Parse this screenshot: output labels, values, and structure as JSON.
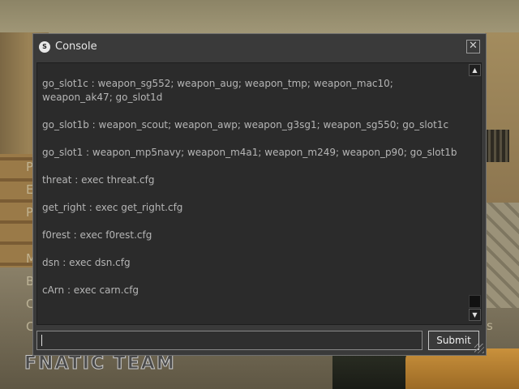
{
  "console": {
    "title": "Console",
    "app_icon": "steam-icon",
    "close_glyph": "✕",
    "lines": [
      "go_slot1c : weapon_sg552; weapon_aug; weapon_tmp; weapon_mac10; weapon_ak47; go_slot1d",
      "go_slot1b : weapon_scout; weapon_awp; weapon_g3sg1; weapon_sg550; go_slot1c",
      "go_slot1 : weapon_mp5navy; weapon_m4a1; weapon_m249; weapon_p90; go_slot1b",
      "threat : exec threat.cfg",
      "get_right : exec get_right.cfg",
      "f0rest : exec f0rest.cfg",
      "dsn : exec dsn.cfg",
      "cArn : exec carn.cfg"
    ],
    "input_value": "",
    "submit_label": "Submit",
    "scroll_up_glyph": "▲",
    "scroll_down_glyph": "▼"
  },
  "background": {
    "team_logo": "FNATIC TEAM",
    "hud_letters": [
      "P",
      "E",
      "P",
      "M",
      "B",
      "C",
      "C",
      "s"
    ]
  },
  "colors": {
    "console_bg": "#3a3a3a",
    "output_bg": "#2b2b2b",
    "text": "#b5b5b5",
    "title_text": "#e6e6e6"
  }
}
